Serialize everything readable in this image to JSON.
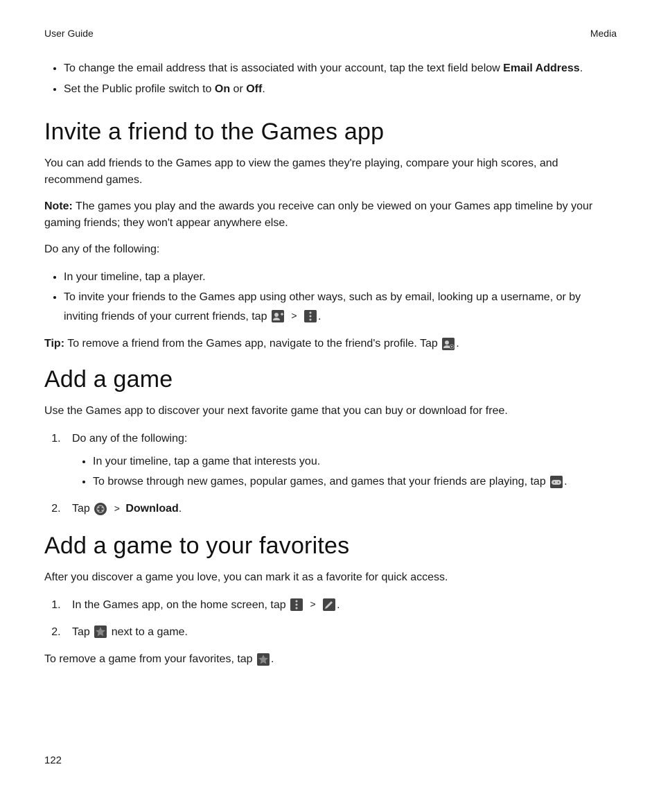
{
  "header": {
    "left": "User Guide",
    "right": "Media"
  },
  "topBullets": {
    "b0_pre": "To change the email address that is associated with your account, tap the text field below ",
    "b0_bold": "Email Address",
    "b0_post": ".",
    "b1_pre": "Set the Public profile switch to ",
    "b1_bold1": "On",
    "b1_mid": " or ",
    "b1_bold2": "Off",
    "b1_post": "."
  },
  "sec1": {
    "heading": "Invite a friend to the Games app",
    "p1": "You can add friends to the Games app to view the games they're playing, compare your high scores, and recommend games.",
    "noteLabel": "Note:",
    "noteText": " The games you play and the awards you receive can only be viewed on your Games app timeline by your gaming friends; they won't appear anywhere else.",
    "p2": "Do any of the following:",
    "li1": "In your timeline, tap a player.",
    "li2_pre": "To invite your friends to the Games app using other ways, such as by email, looking up a username, or by inviting friends of your current friends, tap ",
    "li2_post": ".",
    "tipLabel": "Tip:",
    "tipPre": " To remove a friend from the Games app, navigate to the friend's profile. Tap ",
    "tipPost": "."
  },
  "sec2": {
    "heading": "Add a game",
    "p1": "Use the Games app to discover your next favorite game that you can buy or download for free.",
    "step1_intro": "Do any of the following:",
    "step1_li1": "In your timeline, tap a game that interests you.",
    "step1_li2_pre": "To browse through new games, popular games, and games that your friends are playing, tap ",
    "step1_li2_post": ".",
    "step2_pre": "Tap ",
    "step2_gt": ">",
    "step2_bold": "Download",
    "step2_post": "."
  },
  "sec3": {
    "heading": "Add a game to your favorites",
    "p1": "After you discover a game you love, you can mark it as a favorite for quick access.",
    "step1_pre": "In the Games app, on the home screen, tap ",
    "step1_post": ".",
    "step2_pre": "Tap ",
    "step2_post": " next to a game.",
    "p2_pre": "To remove a game from your favorites, tap ",
    "p2_post": "."
  },
  "gt": ">",
  "pageNumber": "122"
}
